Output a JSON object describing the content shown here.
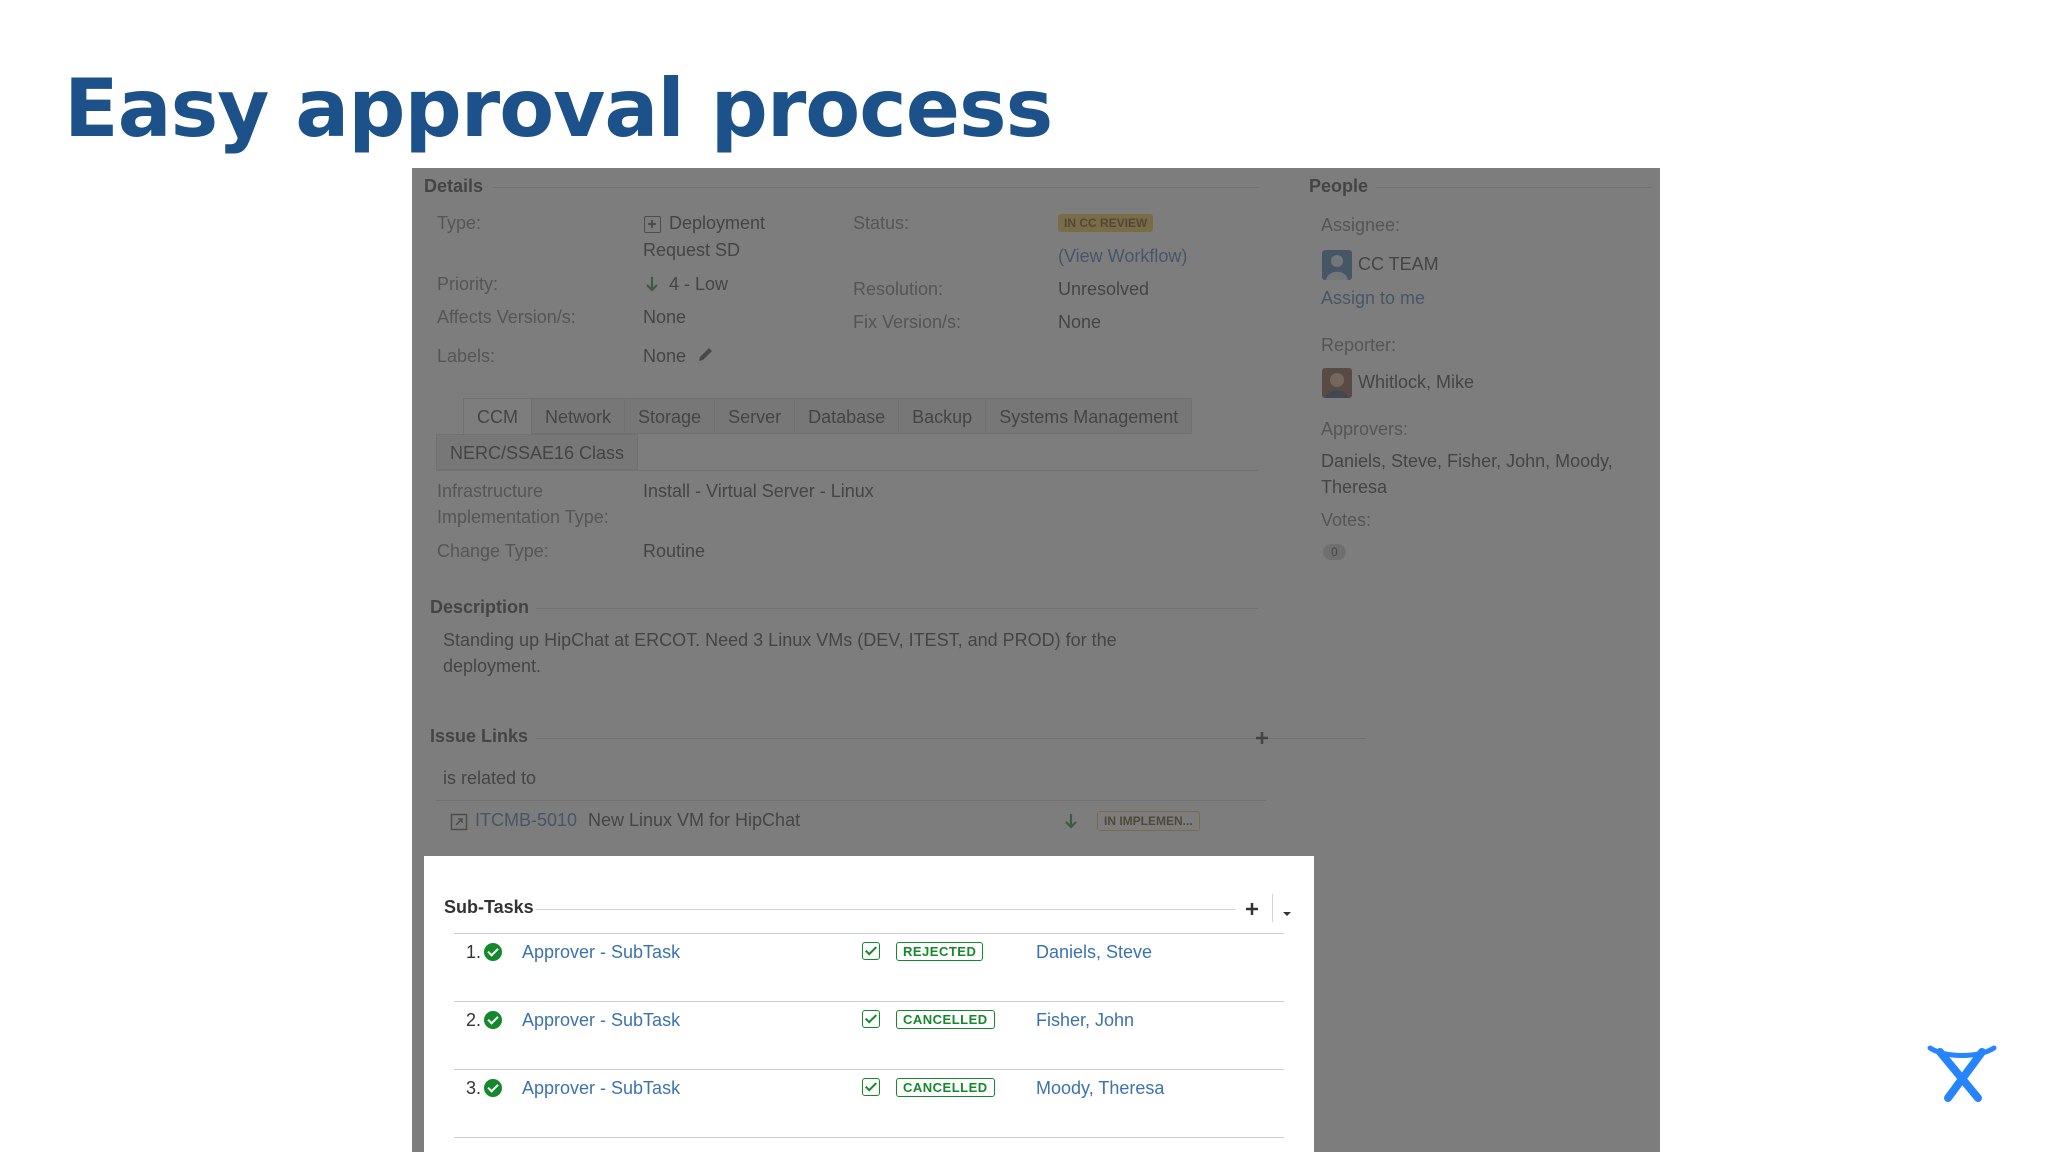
{
  "slide": {
    "title": "Easy approval process"
  },
  "details": {
    "heading": "Details",
    "type_label": "Type:",
    "type_value_line1": "Deployment",
    "type_value_line2": "Request SD",
    "status_label": "Status:",
    "status_value": "IN CC REVIEW",
    "view_workflow": "(View Workflow)",
    "priority_label": "Priority:",
    "priority_value": "4 - Low",
    "resolution_label": "Resolution:",
    "resolution_value": "Unresolved",
    "affects_label": "Affects Version/s:",
    "affects_value": "None",
    "fix_label": "Fix Version/s:",
    "fix_value": "None",
    "labels_label": "Labels:",
    "labels_value": "None"
  },
  "tabs": [
    "CCM",
    "Network",
    "Storage",
    "Server",
    "Database",
    "Backup",
    "Systems Management",
    "NERC/SSAE16 Class"
  ],
  "ccm_fields": {
    "infra_label_line1": "Infrastructure",
    "infra_label_line2": "Implementation Type:",
    "infra_value": "Install - Virtual Server - Linux",
    "change_label": "Change Type:",
    "change_value": "Routine"
  },
  "description": {
    "heading": "Description",
    "line1": "Standing up HipChat at ERCOT. Need 3 Linux VMs (DEV, ITEST, and PROD) for the",
    "line2": "deployment."
  },
  "issue_links": {
    "heading": "Issue Links",
    "relation": "is related to",
    "key": "ITCMB-5010",
    "summary": "New Linux VM for HipChat",
    "status": "IN IMPLEMEN..."
  },
  "people": {
    "heading": "People",
    "assignee_label": "Assignee:",
    "assignee_value": "CC TEAM",
    "assign_to_me": "Assign to me",
    "reporter_label": "Reporter:",
    "reporter_value": "Whitlock, Mike",
    "approvers_label": "Approvers:",
    "approvers_line1": "Daniels, Steve, Fisher, John, Moody,",
    "approvers_line2": "Theresa",
    "votes_label": "Votes:",
    "votes_value": "0"
  },
  "subtasks": {
    "heading": "Sub-Tasks",
    "rows": [
      {
        "num": "1.",
        "summary": "Approver - SubTask",
        "status": "REJECTED",
        "assignee": "Daniels, Steve"
      },
      {
        "num": "2.",
        "summary": "Approver - SubTask",
        "status": "CANCELLED",
        "assignee": "Fisher, John"
      },
      {
        "num": "3.",
        "summary": "Approver - SubTask",
        "status": "CANCELLED",
        "assignee": "Moody, Theresa"
      }
    ]
  },
  "colors": {
    "title_blue": "#1c5189",
    "link_blue": "#3b73af",
    "success_green": "#14892c",
    "status_yellow": "#f6c342",
    "logo_blue": "#2684ff"
  },
  "icons": [
    "plus-icon",
    "chevron-down-icon",
    "check-circle-icon",
    "checkbox-icon",
    "pencil-icon",
    "arrow-down-icon",
    "external-link-icon",
    "atlassian-logo"
  ]
}
